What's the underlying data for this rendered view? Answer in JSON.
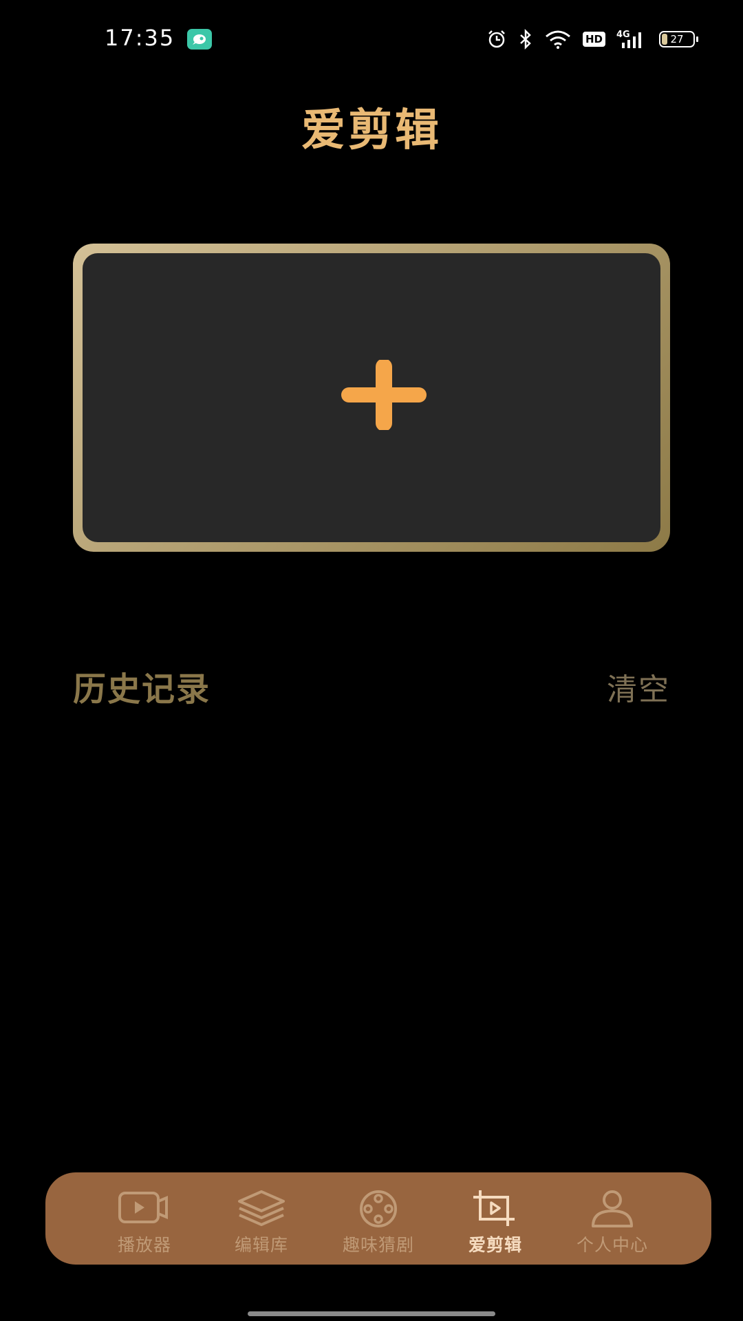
{
  "status_bar": {
    "time": "17:35",
    "battery_level": "27",
    "network": "4G",
    "hd_label": "HD",
    "icons": [
      "app-notification-icon",
      "alarm-icon",
      "bluetooth-icon",
      "wifi-icon",
      "hd-icon",
      "signal-icon",
      "battery-icon"
    ]
  },
  "header": {
    "title": "爱剪辑"
  },
  "add_card": {
    "icon": "plus-icon",
    "accent_color": "#f5a64a"
  },
  "history": {
    "title": "历史记录",
    "clear_label": "清空"
  },
  "bottom_nav": {
    "items": [
      {
        "label": "播放器",
        "icon": "video-camera-icon",
        "active": false
      },
      {
        "label": "编辑库",
        "icon": "layers-icon",
        "active": false
      },
      {
        "label": "趣味猜剧",
        "icon": "film-reel-icon",
        "active": false
      },
      {
        "label": "爱剪辑",
        "icon": "crop-play-icon",
        "active": true
      },
      {
        "label": "个人中心",
        "icon": "person-icon",
        "active": false
      }
    ]
  },
  "colors": {
    "background": "#000000",
    "title": "#e9b974",
    "nav_background": "#98653f",
    "card_inner": "#282828"
  }
}
